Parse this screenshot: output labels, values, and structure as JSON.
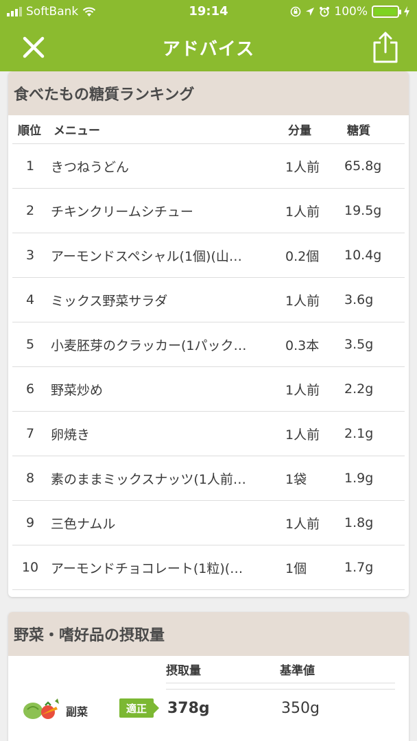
{
  "status": {
    "carrier": "SoftBank",
    "time": "19:14",
    "battery": "100%"
  },
  "nav": {
    "title": "アドバイス",
    "close_icon": "close-icon",
    "share_icon": "share-icon"
  },
  "ranking": {
    "title": "食べたもの糖質ランキング",
    "headers": {
      "rank": "順位",
      "menu": "メニュー",
      "qty": "分量",
      "sugar": "糖質"
    },
    "rows": [
      {
        "rank": "1",
        "menu": "きつねうどん",
        "qty": "1人前",
        "sugar": "65.8g"
      },
      {
        "rank": "2",
        "menu": "チキンクリームシチュー",
        "qty": "1人前",
        "sugar": "19.5g"
      },
      {
        "rank": "3",
        "menu": "アーモンドスペシャル(1個)(山…",
        "qty": "0.2個",
        "sugar": "10.4g"
      },
      {
        "rank": "4",
        "menu": "ミックス野菜サラダ",
        "qty": "1人前",
        "sugar": "3.6g"
      },
      {
        "rank": "5",
        "menu": "小麦胚芽のクラッカー(1パック…",
        "qty": "0.3本",
        "sugar": "3.5g"
      },
      {
        "rank": "6",
        "menu": "野菜炒め",
        "qty": "1人前",
        "sugar": "2.2g"
      },
      {
        "rank": "7",
        "menu": "卵焼き",
        "qty": "1人前",
        "sugar": "2.1g"
      },
      {
        "rank": "8",
        "menu": "素のままミックスナッツ(1人前…",
        "qty": "1袋",
        "sugar": "1.9g"
      },
      {
        "rank": "9",
        "menu": "三色ナムル",
        "qty": "1人前",
        "sugar": "1.8g"
      },
      {
        "rank": "10",
        "menu": "アーモンドチョコレート(1粒)(…",
        "qty": "1個",
        "sugar": "1.7g"
      }
    ]
  },
  "intake": {
    "title": "野菜・嗜好品の摂取量",
    "headers": {
      "amount": "摂取量",
      "standard": "基準値"
    },
    "rows": [
      {
        "label": "副菜",
        "icon": "vegetables-icon",
        "badge": "適正",
        "amount": "378g",
        "standard": "350g"
      }
    ]
  },
  "colors": {
    "accent": "#8bbb2f",
    "badge": "#7cb833",
    "section_header": "#e6ddd5"
  }
}
